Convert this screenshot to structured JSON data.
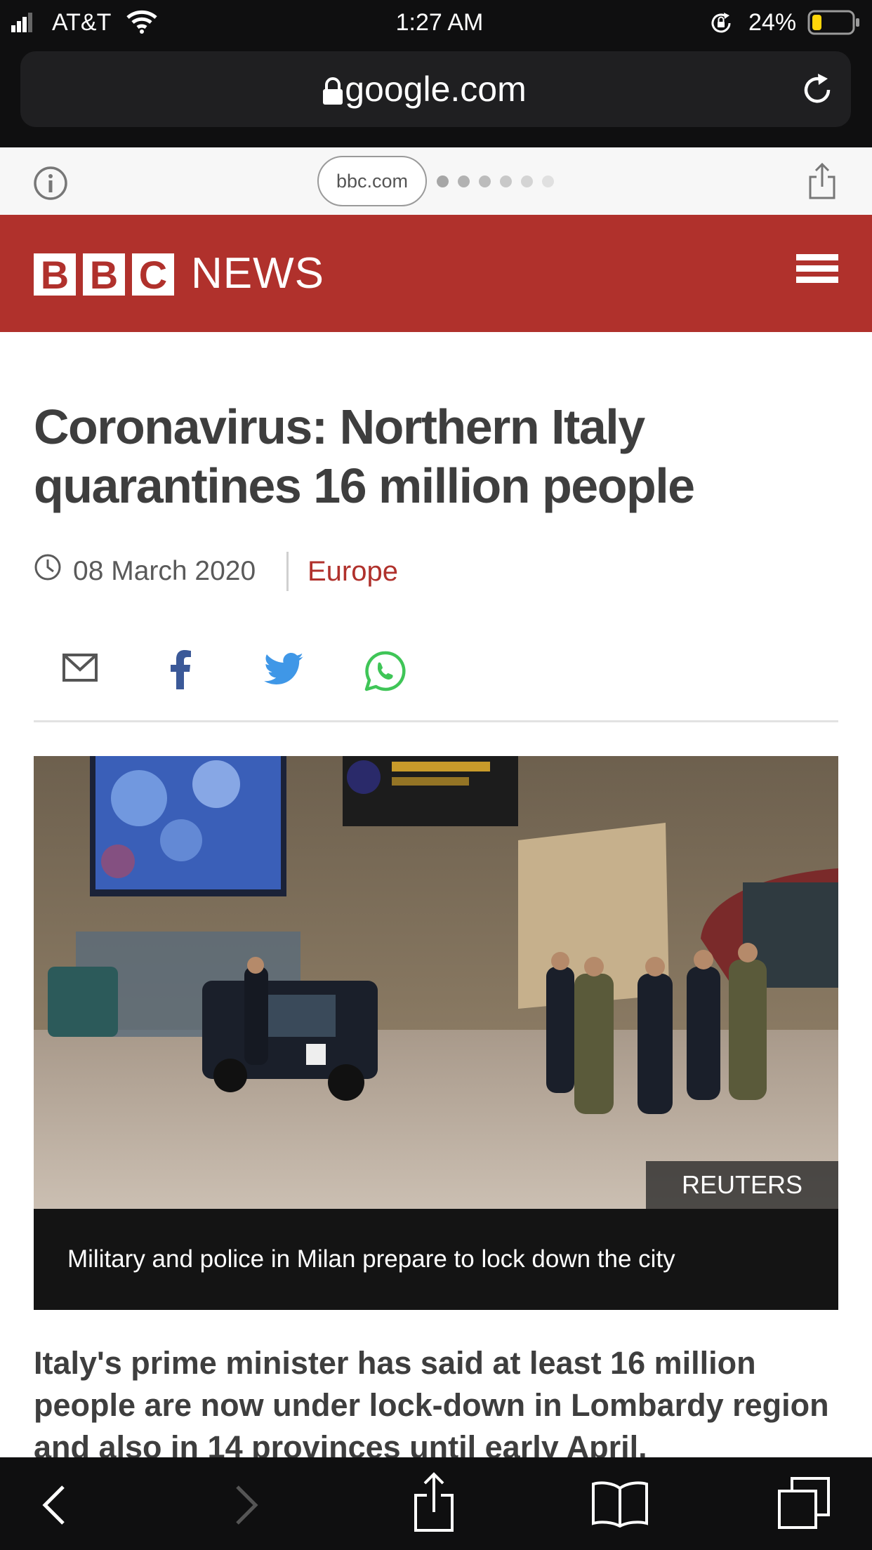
{
  "status_bar": {
    "carrier": "AT&T",
    "time": "1:27 AM",
    "battery_percent": "24%",
    "battery_level": 0.24,
    "icons": [
      "signal-icon",
      "wifi-icon",
      "orientation-lock-icon",
      "battery-icon"
    ]
  },
  "browser": {
    "url": "google.com",
    "icons": [
      "lock-icon",
      "reload-icon"
    ]
  },
  "amp_bar": {
    "domain": "bbc.com",
    "icons": [
      "info-icon",
      "share-icon"
    ]
  },
  "site_header": {
    "logo_letters": [
      "B",
      "B",
      "C"
    ],
    "logo_word": "NEWS",
    "icons": [
      "hamburger-menu-icon"
    ],
    "colors": {
      "brand_red": "#b0312c"
    }
  },
  "article": {
    "headline": "Coronavirus: Northern Italy quarantines 16 million people",
    "date": "08 March 2020",
    "section": "Europe",
    "share_icons": [
      "email-icon",
      "facebook-icon",
      "twitter-icon",
      "whatsapp-icon"
    ],
    "image_credit": "REUTERS",
    "image_caption": "Military and police in Milan prepare to lock down the city",
    "lede": "Italy's prime minister has said at least 16 million people are now under lock-down in Lombardy region and also in 14 provinces until early April."
  },
  "toolbar": {
    "icons": [
      "back-icon",
      "forward-icon",
      "share-icon",
      "bookmarks-icon",
      "tabs-icon"
    ]
  }
}
